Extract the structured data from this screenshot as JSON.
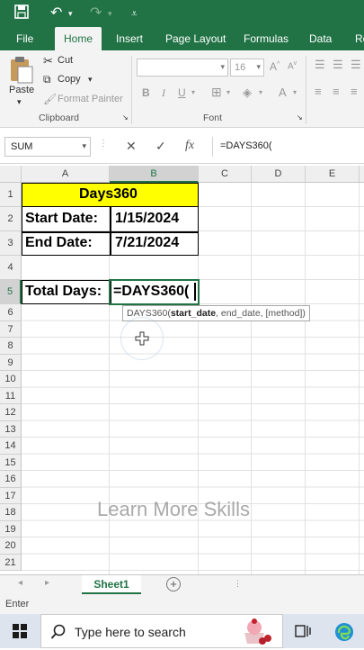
{
  "ribbon_tabs": [
    "File",
    "Home",
    "Insert",
    "Page Layout",
    "Formulas",
    "Data",
    "Re"
  ],
  "active_tab": "Home",
  "clipboard": {
    "paste": "Paste",
    "cut": "Cut",
    "copy": "Copy",
    "format_painter": "Format Painter",
    "label": "Clipboard"
  },
  "font_group": {
    "size": "16",
    "label": "Font"
  },
  "name_box": "SUM",
  "formula_bar": "=DAYS360(",
  "columns": [
    "A",
    "B",
    "C",
    "D",
    "E"
  ],
  "rows": [
    "1",
    "2",
    "3",
    "4",
    "5",
    "6",
    "7",
    "8",
    "9",
    "10",
    "11",
    "12",
    "13",
    "14",
    "15",
    "16",
    "17",
    "18",
    "19",
    "20",
    "21"
  ],
  "cells": {
    "b1_title": "Days360",
    "a2": "Start Date:",
    "b2": "1/15/2024",
    "a3": "End Date:",
    "b3": "7/21/2024",
    "a5": "Total Days:",
    "b5": "=DAYS360("
  },
  "tooltip": {
    "fn": "DAYS360(",
    "arg1": "start_date",
    "rest": ", end_date, [method])"
  },
  "watermark": "Learn More Skills",
  "sheet_tab": "Sheet1",
  "status": "Enter",
  "taskbar": {
    "search_placeholder": "Type here to search"
  },
  "colors": {
    "excel_green": "#217346",
    "title_fill": "#ffff00"
  }
}
